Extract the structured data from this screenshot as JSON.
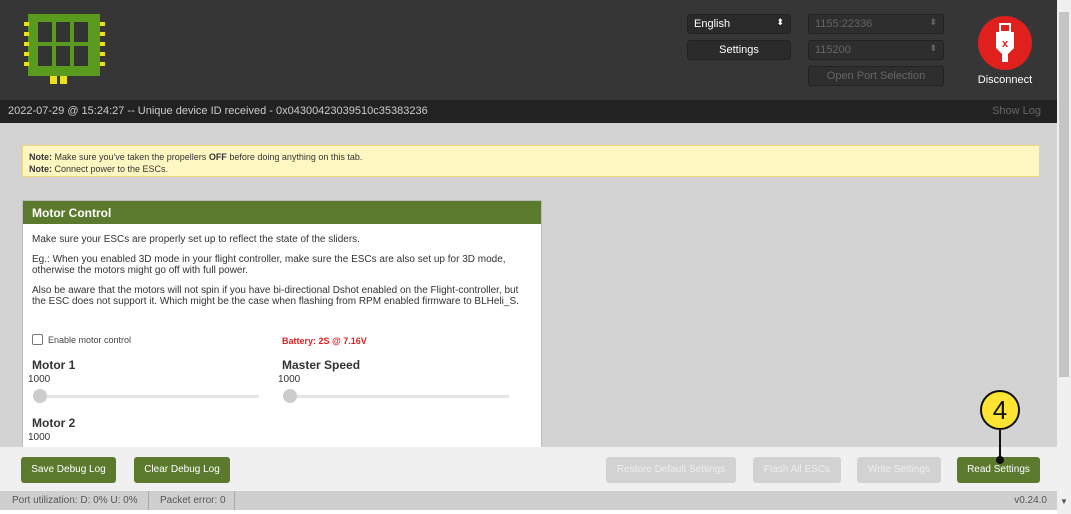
{
  "header": {
    "language": "English",
    "settings_label": "Settings",
    "port": "1155:22336",
    "baud": "115200",
    "open_port_label": "Open Port Selection",
    "disconnect_label": "Disconnect"
  },
  "log": {
    "message": "2022-07-29 @ 15:24:27 -- Unique device ID received - 0x04300423039510c35383236",
    "show_log": "Show Log"
  },
  "note": {
    "line1_prefix": "Note:",
    "line1_a": " Make sure you've taken the propellers ",
    "line1_bold": "OFF",
    "line1_b": " before doing anything on this tab.",
    "line2_prefix": "Note:",
    "line2": " Connect power to the ESCs."
  },
  "motor_control": {
    "title": "Motor Control",
    "p1": "Make sure your ESCs are properly set up to reflect the state of the sliders.",
    "p2": "Eg.: When you enabled 3D mode in your flight controller, make sure the ESCs are also set up for 3D mode, otherwise the motors might go off with full power.",
    "p3": "Also be aware that the motors will not spin if you have bi-directional Dshot enabled on the Flight-controller, but the ESC does not support it. Which might be the case when flashing from RPM enabled firmware to BLHeli_S.",
    "enable_label": "Enable motor control",
    "battery": "Battery: 2S @ 7.16V",
    "sliders": [
      {
        "label": "Motor 1",
        "value": "1000"
      },
      {
        "label": "Master Speed",
        "value": "1000"
      },
      {
        "label": "Motor 2",
        "value": "1000"
      }
    ]
  },
  "buttons": {
    "save_debug": "Save Debug Log",
    "clear_debug": "Clear Debug Log",
    "restore": "Restore Default Settings",
    "flash_all": "Flash All ESCs",
    "write": "Write Settings",
    "read": "Read Settings"
  },
  "status": {
    "port_util": "Port utilization: D: 0% U: 0%",
    "packet_error": "Packet error: 0",
    "version": "v0.24.0"
  },
  "annotation": "4"
}
